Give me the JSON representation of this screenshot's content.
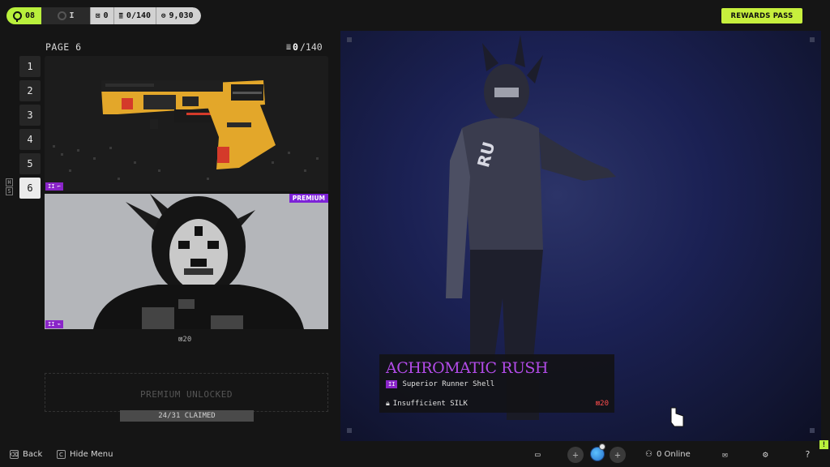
{
  "topbar": {
    "level": "08",
    "progress_label": "I",
    "stat_a": "0",
    "stat_b": "0/140",
    "stat_c": "9,030",
    "rewards_button": "REWARDS PASS",
    "colors": {
      "accent": "#b9f03c",
      "premium": "#7d22d8"
    }
  },
  "left": {
    "page_title": "PAGE 6",
    "count_owned": "0",
    "count_total": "/140",
    "pages": [
      "1",
      "2",
      "3",
      "4",
      "5",
      "6"
    ],
    "active_page": "6",
    "shortcut_keys": [
      "H",
      "S"
    ],
    "card_weapon": {
      "tier": "II"
    },
    "card_skin": {
      "badge": "PREMIUM",
      "tier": "II"
    },
    "price_under": "20",
    "unlocked_text": "PREMIUM UNLOCKED",
    "claimed": "24/31 CLAIMED"
  },
  "showcase": {
    "item_name": "ACHROMATIC RUSH",
    "tier": "II",
    "item_type": "Superior Runner Shell",
    "status": "Insufficient SILK",
    "price": "20"
  },
  "bottombar": {
    "back_label": "Back",
    "back_key": "⌫",
    "hide_label": "Hide Menu",
    "hide_key": "C",
    "online_label": "0 Online",
    "help": "?",
    "warn": "!"
  }
}
